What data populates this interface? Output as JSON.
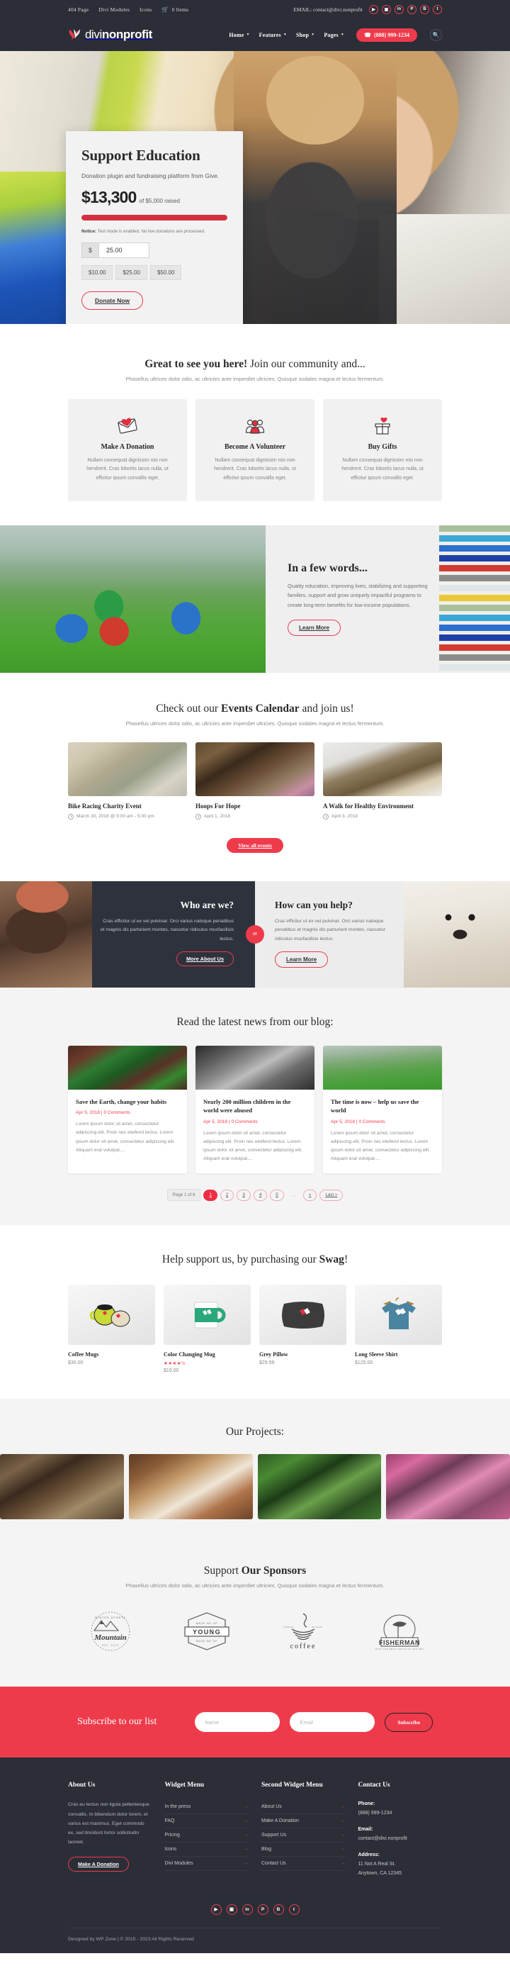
{
  "topbar": {
    "links": [
      {
        "label": "404 Page"
      },
      {
        "label": "Divi Modules"
      },
      {
        "label": "Icons"
      }
    ],
    "cart_label": "0 Items",
    "cart_icon": "cart-icon",
    "email_label": "EMAIL: contact@divi.nonprofit",
    "social": [
      {
        "name": "youtube",
        "glyph": "▶"
      },
      {
        "name": "instagram",
        "glyph": "▣"
      },
      {
        "name": "linkedin",
        "glyph": "in"
      },
      {
        "name": "pinterest",
        "glyph": "P"
      },
      {
        "name": "behance",
        "glyph": "B"
      },
      {
        "name": "tumblr",
        "glyph": "t"
      }
    ]
  },
  "header": {
    "brand_light": "divi",
    "brand_bold": "nonprofit",
    "nav": [
      {
        "label": "Home",
        "has_caret": true
      },
      {
        "label": "Features",
        "has_caret": true
      },
      {
        "label": "Shop",
        "has_caret": true
      },
      {
        "label": "Pages",
        "has_caret": true
      }
    ],
    "phone_label": "(888) 999-1234",
    "phone_icon": "phone-icon",
    "search_icon": "search-icon"
  },
  "hero": {
    "title": "Support Education",
    "subtitle": "Donation plugin and fundraising platform from Give.",
    "amount_raised": "$13,300",
    "goal_text": "of $5,000 raised",
    "progress_percent": 100,
    "notice_label": "Notice:",
    "notice_text": " Test mode is enabled. No live donations are processed.",
    "currency_symbol": "$",
    "amount_value": "25.00",
    "presets": [
      "$10.00",
      "$25.00",
      "$50.00"
    ],
    "donate_label": "Donate Now"
  },
  "community": {
    "title_bold": "Great to see you here!",
    "title_rest": " Join our community and...",
    "subtitle": "Phasellus ultrices dolor odio, ac ultricies ante imperdiet ultricies. Quisque sodales magna et lectus fermentum.",
    "cards": [
      {
        "icon": "donation-envelope-heart-icon",
        "title": "Make A Donation",
        "body": "Nullam consequat dignissim nisi non hendrerit. Cras lobortis lacus nulla, ut efficitur ipsum convallis eget."
      },
      {
        "icon": "volunteer-people-icon",
        "title": "Become A Volunteer",
        "body": "Nullam consequat dignissim nisi non hendrerit. Cras lobortis lacus nulla, ut efficitur ipsum convallis eget."
      },
      {
        "icon": "gift-box-heart-icon",
        "title": "Buy Gifts",
        "body": "Nullam consequat dignissim nisi non hendrerit. Cras lobortis lacus nulla, ut efficitur ipsum convallis eget."
      }
    ]
  },
  "fewwords": {
    "title": "In a few words...",
    "body": "Quality education, improving lives, stabilizing and supporting families, support and grow uniquely impactful programs to create long-term benefits for low-income populations.",
    "button_label": "Learn More"
  },
  "events": {
    "title_pre": "Check out our ",
    "title_bold": "Events Calendar",
    "title_post": " and join us!",
    "subtitle": "Phasellus ultrices dolor odio, ac ultricies ante imperdiet ultricies. Quisque sodales magna et lectus fermentum.",
    "items": [
      {
        "title": "Bike Racing Charity Event",
        "date": "March 30, 2018 @ 8:00 am - 5:00 pm",
        "icon": "clock-icon"
      },
      {
        "title": "Hoops For Hope",
        "date": "April 1, 2018",
        "icon": "clock-icon"
      },
      {
        "title": "A Walk for Healthy Environment",
        "date": "April 3, 2018",
        "icon": "clock-icon"
      }
    ],
    "view_all_label": "View all events"
  },
  "whowe": {
    "left": {
      "title": "Who are we?",
      "body": "Cras efficitur ut ex vel pulvinar. Orci varius natoque penatibus et magnis dis parturient montes, nascetur ridiculus musfacilisis lectus.",
      "button_label": "More About Us"
    },
    "divider_label": "or",
    "right": {
      "title": "How can you help?",
      "body": "Cras efficitur ut ex vel pulvinar. Orci varius natoque penatibus et magnis dis parturient montes, nascetur ridiculus musfacilisis lectus.",
      "button_label": "Learn More"
    }
  },
  "blog": {
    "title": "Read the latest news from our blog:",
    "posts": [
      {
        "title": "Save the Earth, change your habits",
        "meta": "Apr 5, 2018 | 0 Comments",
        "excerpt": "Lorem ipsum dolor sit amet, consectetur adipiscing elit. Proin nec eleifend lectus. Lorem ipsum dolor sit amet, consectetur adipiscing elit. Aliquam erat volutpat...."
      },
      {
        "title": "Nearly 200 million children in the world were abused",
        "meta": "Apr 5, 2018 | 0 Comments",
        "excerpt": "Lorem ipsum dolor sit amet, consectetur adipiscing elit. Proin nec eleifend lectus. Lorem ipsum dolor sit amet, consectetur adipiscing elit. Aliquam erat volutpat...."
      },
      {
        "title": "The time is now – help us save the world",
        "meta": "Apr 5, 2018 | 0 Comments",
        "excerpt": "Lorem ipsum dolor sit amet, consectetur adipiscing elit. Proin nec eleifend lectus. Lorem ipsum dolor sit amet, consectetur adipiscing elit. Aliquam erat volutpat...."
      }
    ],
    "pagination": {
      "page_label": "Page 1 of 6",
      "pages": [
        "1",
        "2",
        "3",
        "4",
        "5"
      ],
      "active": "1",
      "dots": "...",
      "next_label": "»",
      "last_label": "Last »"
    }
  },
  "swag": {
    "title_pre": "Help support us, by purchasing our ",
    "title_bold": "Swag",
    "title_post": "!",
    "products": [
      {
        "name": "Coffee Mugs",
        "price": "$30.00",
        "rating": "",
        "icon": "coffee-mugs-icon"
      },
      {
        "name": "Color Changing Mug",
        "price": "$19.00",
        "rating": "★★★★½",
        "icon": "color-changing-mug-icon"
      },
      {
        "name": "Grey Pillow",
        "price": "$29.99",
        "rating": "",
        "icon": "grey-pillow-icon"
      },
      {
        "name": "Long Sleeve Shirt",
        "price": "$125.00",
        "rating": "",
        "icon": "long-sleeve-shirt-icon"
      }
    ]
  },
  "projects": {
    "title": "Our Projects:",
    "items": [
      {
        "name": "classroom-children"
      },
      {
        "name": "child-writing"
      },
      {
        "name": "children-on-swings"
      },
      {
        "name": "festival-children"
      }
    ]
  },
  "sponsors": {
    "title_pre": "Support ",
    "title_bold": "Our Sponsors",
    "subtitle": "Phasellus ultrices dolor odio, ac ultricies ante imperdiet ultricies. Quisque sodales magna et lectus fermentum.",
    "logos": [
      {
        "name": "Mountain",
        "tagline_top": "WINTER SPORTS",
        "tagline_bottom": "EST. 1972"
      },
      {
        "name": "YOUNG",
        "tagline_top": "MADE ME UP",
        "tagline_bottom": "MADE ME UP"
      },
      {
        "name": "coffee",
        "tagline_top": "FRESH",
        "tagline_bottom": "BLEND"
      },
      {
        "name": "FISHERMAN",
        "tagline_top": "",
        "tagline_bottom": "WITH THE BEST CATCH OF THE SEA"
      }
    ]
  },
  "subscribe": {
    "title": "Subscribe to our list",
    "name_placeholder": "Name",
    "email_placeholder": "Email",
    "button_label": "Subscribe"
  },
  "footer": {
    "about": {
      "heading": "About Us",
      "body": "Cras eu lectus non ligula pellentesque convallis. In bibendum dolor lorem, et varius est maximus. Eget commodo ex, sed tincidunt tortor sollicitudin laoreet.",
      "button_label": "Make A Donation"
    },
    "widget_menu": {
      "heading": "Widget Menu",
      "links": [
        "In the press",
        "FAQ",
        "Pricing",
        "Icons",
        "Divi Modules"
      ]
    },
    "second_widget_menu": {
      "heading": "Second Widget Menu",
      "links": [
        "About Us",
        "Make A Donation",
        "Support Us",
        "Blog",
        "Contact Us"
      ]
    },
    "contact": {
      "heading": "Contact Us",
      "phone_label": "Phone:",
      "phone_value": "(888) 999-1234",
      "email_label": "Email:",
      "email_value": "contact@divi.nonprofit",
      "address_label": "Address:",
      "address_line1": "11 Not A Real St.",
      "address_line2": "Anytown, CA 12345"
    },
    "social": [
      {
        "name": "youtube",
        "glyph": "▶"
      },
      {
        "name": "instagram",
        "glyph": "▣"
      },
      {
        "name": "linkedin",
        "glyph": "in"
      },
      {
        "name": "pinterest",
        "glyph": "P"
      },
      {
        "name": "behance",
        "glyph": "B"
      },
      {
        "name": "tumblr",
        "glyph": "t"
      }
    ],
    "copyright": "Designed by WP Zone | © 2015 - 2023 All Rights Reserved"
  },
  "colors": {
    "accent": "#ee3b4c",
    "dark": "#2b2e37",
    "light_gray": "#f4f4f4"
  }
}
